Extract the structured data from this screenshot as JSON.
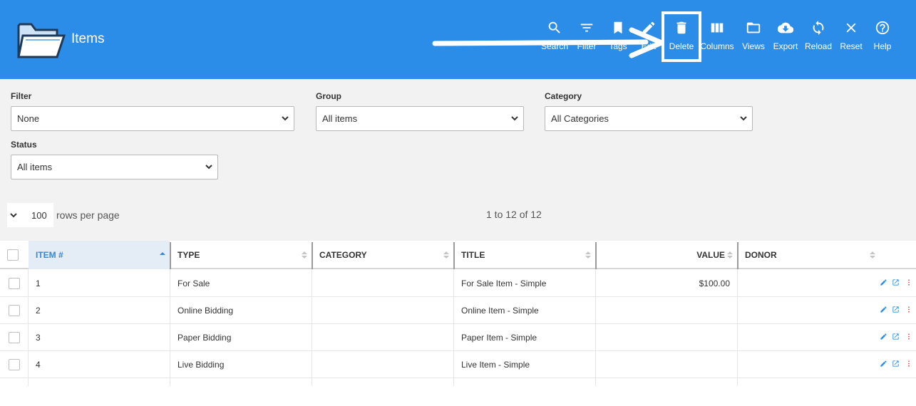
{
  "app": {
    "title": "Items"
  },
  "toolbar": [
    {
      "label": "Search",
      "icon": "search-icon"
    },
    {
      "label": "Filter",
      "icon": "filter-icon"
    },
    {
      "label": "Tags",
      "icon": "bookmark-icon"
    },
    {
      "label": "Edit",
      "icon": "pencil-icon"
    },
    {
      "label": "Delete",
      "icon": "trash-icon"
    },
    {
      "label": "Columns",
      "icon": "columns-icon"
    },
    {
      "label": "Views",
      "icon": "folder-icon"
    },
    {
      "label": "Export",
      "icon": "cloud-download-icon"
    },
    {
      "label": "Reload",
      "icon": "reload-icon"
    },
    {
      "label": "Reset",
      "icon": "close-icon"
    },
    {
      "label": "Help",
      "icon": "help-icon"
    }
  ],
  "filters": {
    "filter": {
      "label": "Filter",
      "value": "None"
    },
    "group": {
      "label": "Group",
      "value": "All items"
    },
    "category": {
      "label": "Category",
      "value": "All Categories"
    },
    "status": {
      "label": "Status",
      "value": "All items"
    }
  },
  "pagination": {
    "rows_per_page": "100",
    "rows_label": "rows per page",
    "range": "1 to 12 of 12"
  },
  "table": {
    "columns": [
      "ITEM #",
      "TYPE",
      "CATEGORY",
      "TITLE",
      "VALUE",
      "DONOR"
    ],
    "rows": [
      {
        "item": "1",
        "type": "For Sale",
        "category": "",
        "title": "For Sale Item - Simple",
        "value": "$100.00",
        "donor": ""
      },
      {
        "item": "2",
        "type": "Online Bidding",
        "category": "",
        "title": "Online Item - Simple",
        "value": "",
        "donor": ""
      },
      {
        "item": "3",
        "type": "Paper Bidding",
        "category": "",
        "title": "Paper Item - Simple",
        "value": "",
        "donor": ""
      },
      {
        "item": "4",
        "type": "Live Bidding",
        "category": "",
        "title": "Live Item - Simple",
        "value": "",
        "donor": ""
      }
    ]
  },
  "colors": {
    "header_bg": "#2b8de8",
    "filter_bg": "#f2f2f2",
    "accent": "#3b86d6",
    "action_red": "#d9534f"
  }
}
